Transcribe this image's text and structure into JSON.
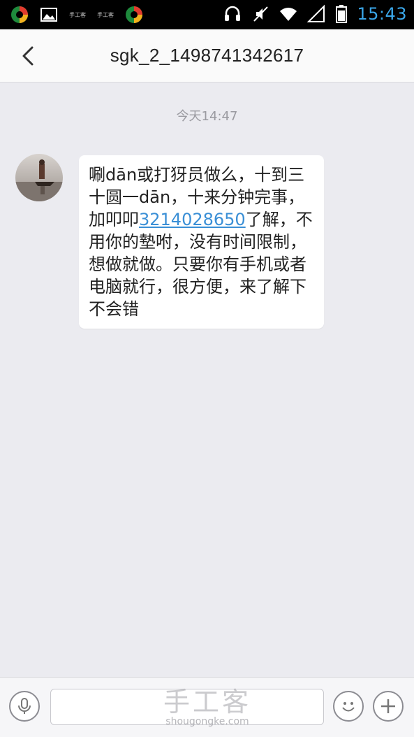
{
  "status_bar": {
    "time": "15:43",
    "tiny_label_1": "手工客",
    "tiny_label_2": "手工客",
    "icons": [
      "app-icon",
      "gallery-icon",
      "app-icon",
      "headset-icon",
      "mute-icon",
      "wifi-icon",
      "signal-icon",
      "battery-icon"
    ]
  },
  "header": {
    "title": "sgk_2_1498741342617",
    "back_icon": "chevron-left-icon"
  },
  "chat": {
    "timestamp": "今天14:47",
    "message": {
      "text_before": "唰dān或打犽员做么，十到三十圆一dān，十来分钟完事，加叩叩",
      "link": "3214028650",
      "text_after": "了解，不用你的墊咐，没有时间限制，想做就做。只要你有手机或者电脑就行，很方便，来了解下不会错"
    }
  },
  "input_bar": {
    "voice_icon": "microphone-icon",
    "emoji_icon": "smiley-icon",
    "plus_icon": "plus-icon"
  },
  "watermark": {
    "title": "手工客",
    "url": "shougongke.com"
  },
  "colors": {
    "accent": "#3aa6e8",
    "background": "#ebebf0",
    "link": "#3a8fd6"
  }
}
